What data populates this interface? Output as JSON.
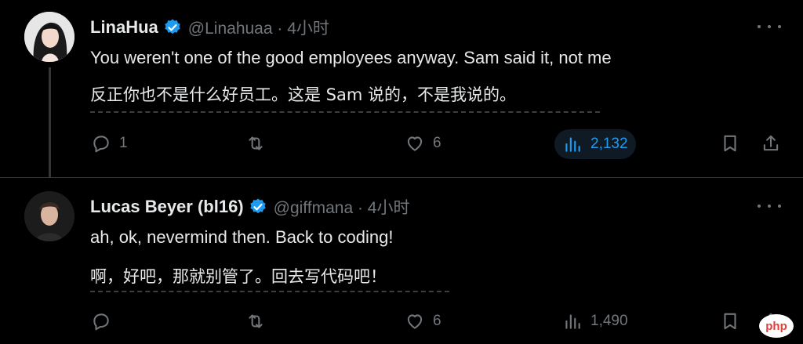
{
  "tweets": [
    {
      "author_name": "LinaHua",
      "handle_time": "@Linahuaa · 4小时",
      "text_en": "You weren't one of the good employees anyway. Sam said it, not me",
      "text_zh": "反正你也不是什么好员工。这是 Sam 说的，不是我说的。",
      "replies": "1",
      "retweets": "",
      "likes": "6",
      "views": "2,132"
    },
    {
      "author_name": "Lucas Beyer (bl16)",
      "handle_time": "@giffmana · 4小时",
      "text_en": "ah, ok, nevermind then. Back to coding!",
      "text_zh": "啊，好吧，那就别管了。回去写代码吧！",
      "replies": "",
      "retweets": "",
      "likes": "6",
      "views": "1,490"
    }
  ],
  "watermark": "php",
  "colors": {
    "background": "#000000",
    "text": "#e7e9ea",
    "muted": "#71767b",
    "accent": "#1d9bf0"
  },
  "icons": [
    "verified-badge-icon",
    "more-icon",
    "reply-icon",
    "retweet-icon",
    "like-icon",
    "views-icon",
    "bookmark-icon",
    "share-icon"
  ]
}
